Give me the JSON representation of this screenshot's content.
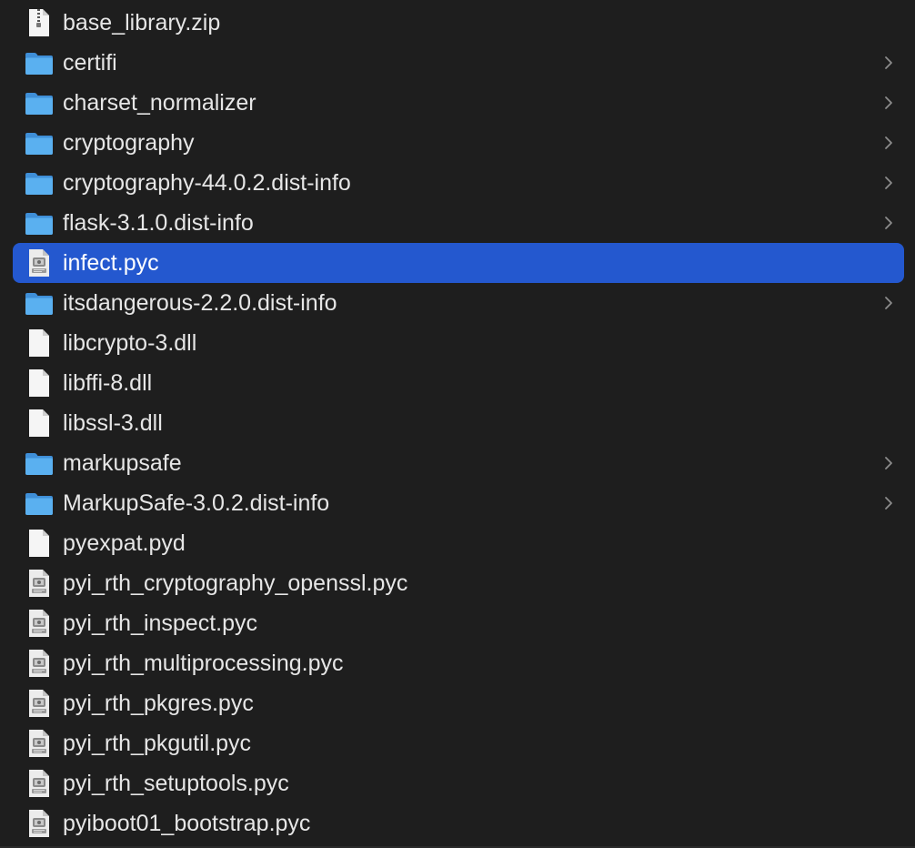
{
  "files": [
    {
      "name": "base_library.zip",
      "kind": "zip",
      "selected": false,
      "expandable": false
    },
    {
      "name": "certifi",
      "kind": "folder",
      "selected": false,
      "expandable": true
    },
    {
      "name": "charset_normalizer",
      "kind": "folder",
      "selected": false,
      "expandable": true
    },
    {
      "name": "cryptography",
      "kind": "folder",
      "selected": false,
      "expandable": true
    },
    {
      "name": "cryptography-44.0.2.dist-info",
      "kind": "folder",
      "selected": false,
      "expandable": true
    },
    {
      "name": "flask-3.1.0.dist-info",
      "kind": "folder",
      "selected": false,
      "expandable": true
    },
    {
      "name": "infect.pyc",
      "kind": "pyc",
      "selected": true,
      "expandable": false
    },
    {
      "name": "itsdangerous-2.2.0.dist-info",
      "kind": "folder",
      "selected": false,
      "expandable": true
    },
    {
      "name": "libcrypto-3.dll",
      "kind": "file",
      "selected": false,
      "expandable": false
    },
    {
      "name": "libffi-8.dll",
      "kind": "file",
      "selected": false,
      "expandable": false
    },
    {
      "name": "libssl-3.dll",
      "kind": "file",
      "selected": false,
      "expandable": false
    },
    {
      "name": "markupsafe",
      "kind": "folder",
      "selected": false,
      "expandable": true
    },
    {
      "name": "MarkupSafe-3.0.2.dist-info",
      "kind": "folder",
      "selected": false,
      "expandable": true
    },
    {
      "name": "pyexpat.pyd",
      "kind": "file",
      "selected": false,
      "expandable": false
    },
    {
      "name": "pyi_rth_cryptography_openssl.pyc",
      "kind": "pyc",
      "selected": false,
      "expandable": false
    },
    {
      "name": "pyi_rth_inspect.pyc",
      "kind": "pyc",
      "selected": false,
      "expandable": false
    },
    {
      "name": "pyi_rth_multiprocessing.pyc",
      "kind": "pyc",
      "selected": false,
      "expandable": false
    },
    {
      "name": "pyi_rth_pkgres.pyc",
      "kind": "pyc",
      "selected": false,
      "expandable": false
    },
    {
      "name": "pyi_rth_pkgutil.pyc",
      "kind": "pyc",
      "selected": false,
      "expandable": false
    },
    {
      "name": "pyi_rth_setuptools.pyc",
      "kind": "pyc",
      "selected": false,
      "expandable": false
    },
    {
      "name": "pyiboot01_bootstrap.pyc",
      "kind": "pyc",
      "selected": false,
      "expandable": false
    }
  ],
  "colors": {
    "background": "#1e1e1e",
    "selection": "#2458cf",
    "folder": "#5ab0f0",
    "text": "#e6e6e6"
  },
  "icons": {
    "folder": "folder-icon",
    "file": "document-icon",
    "zip": "zip-archive-icon",
    "pyc": "python-file-icon",
    "chevron": "chevron-right-icon"
  }
}
